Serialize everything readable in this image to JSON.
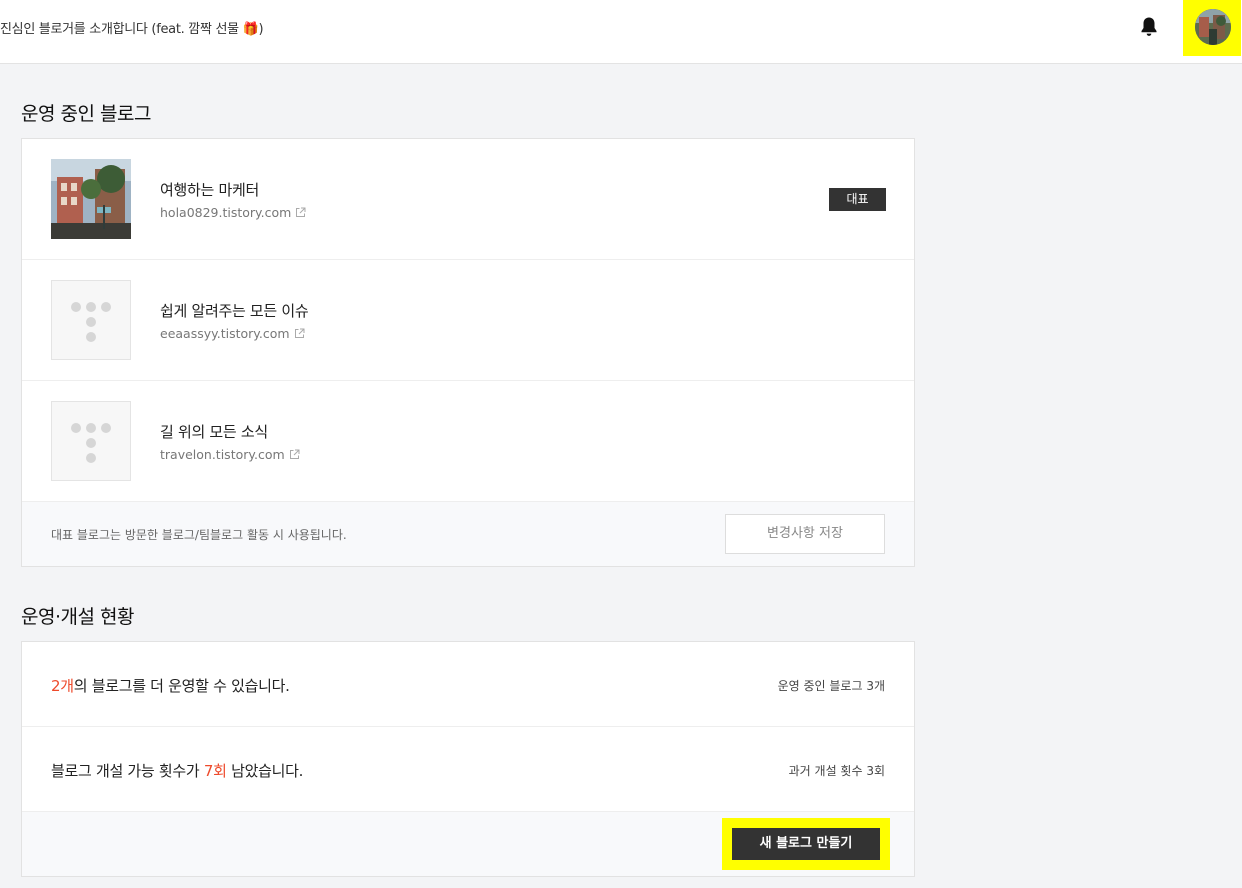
{
  "header": {
    "notice_text": "진심인 블로거를 소개합니다 (feat. 깜짝 선물 🎁)"
  },
  "blogs_section": {
    "title": "운영 중인 블로그",
    "items": [
      {
        "name": "여행하는 마케터",
        "url": "hola0829.tistory.com",
        "badge": "대표"
      },
      {
        "name": "쉽게 알려주는 모든 이슈",
        "url": "eeaassyy.tistory.com"
      },
      {
        "name": "길 위의 모든 소식",
        "url": "travelon.tistory.com"
      }
    ],
    "footer_note": "대표 블로그는 방문한 블로그/팀블로그 활동 시 사용됩니다.",
    "save_button": "변경사항 저장"
  },
  "status_section": {
    "title": "운영·개설 현황",
    "row1": {
      "highlight": "2개",
      "rest": "의 블로그를 더 운영할 수 있습니다.",
      "side": "운영 중인 블로그 3개"
    },
    "row2": {
      "prefix": "블로그 개설 가능 횟수가 ",
      "highlight": "7회",
      "rest": " 남았습니다.",
      "side": "과거 개설 횟수 3회"
    },
    "create_button": "새 블로그 만들기"
  },
  "colors": {
    "highlight": "#ee4a2b",
    "accent_marker": "#ffff00",
    "dark_button": "#333333"
  }
}
